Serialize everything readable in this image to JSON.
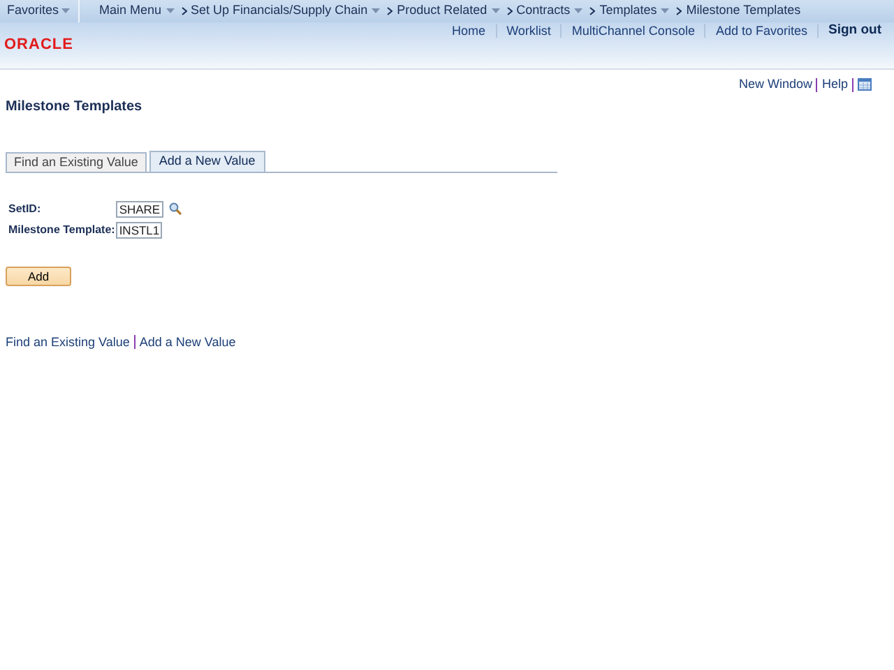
{
  "menu_bar": {
    "favorites": {
      "label": "Favorites",
      "has_dropdown": true
    },
    "breadcrumb": [
      {
        "label": "Main Menu",
        "has_dropdown": true
      },
      {
        "label": "Set Up Financials/Supply Chain",
        "has_dropdown": true
      },
      {
        "label": "Product Related",
        "has_dropdown": true
      },
      {
        "label": "Contracts",
        "has_dropdown": true
      },
      {
        "label": "Templates",
        "has_dropdown": true
      },
      {
        "label": "Milestone Templates",
        "has_dropdown": false
      }
    ]
  },
  "header": {
    "logo": "ORACLE",
    "links": [
      {
        "label": "Home",
        "kind": "link"
      },
      {
        "label": "Worklist",
        "kind": "link"
      },
      {
        "label": "MultiChannel Console",
        "kind": "link"
      },
      {
        "label": "Add to Favorites",
        "kind": "link"
      },
      {
        "label": "Sign out",
        "kind": "strong"
      }
    ]
  },
  "page_links": [
    "New Window",
    "Help"
  ],
  "page_title": "Milestone Templates",
  "tabs": [
    {
      "label": "Find an Existing Value",
      "selected": false
    },
    {
      "label": "Add a New Value",
      "selected": true
    }
  ],
  "fields": [
    {
      "label": "SetID:",
      "value": "SHARE",
      "lookup": true
    },
    {
      "label": "Milestone Template:",
      "value": "INSTL1",
      "lookup": false
    }
  ],
  "add_button": "Add",
  "bottom_links": [
    "Find an Existing Value",
    "Add a New Value"
  ]
}
